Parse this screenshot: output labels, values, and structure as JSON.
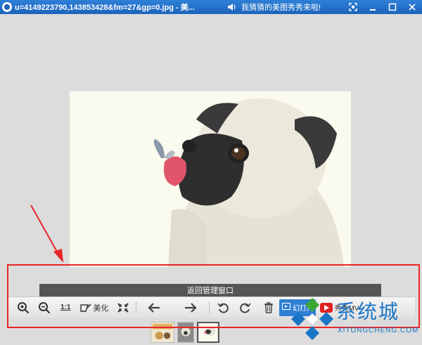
{
  "window": {
    "title": "u=4149223790,143853428&fm=27&gp=0.jpg - 美...",
    "marquee": "我猜猜的美图秀秀来啦!"
  },
  "viewer": {
    "back_label": "返回管理窗口"
  },
  "toolbar": {
    "actual_size_label": "1:1",
    "beautify_label": "美化",
    "slideshow_label": "幻灯片",
    "mv_label": "秀秀MV"
  },
  "watermark": {
    "text": "系统城",
    "sub": "XITONGCHENG.COM"
  },
  "colors": {
    "titlebar": "#1c63bb",
    "highlight": "#e8262a",
    "accent": "#2f7fd4"
  },
  "icons": [
    "zoom-in-icon",
    "zoom-out-icon",
    "beautify-icon",
    "shrink-icon",
    "prev-arrow-icon",
    "next-arrow-icon",
    "rotate-left-icon",
    "rotate-right-icon",
    "delete-icon"
  ]
}
